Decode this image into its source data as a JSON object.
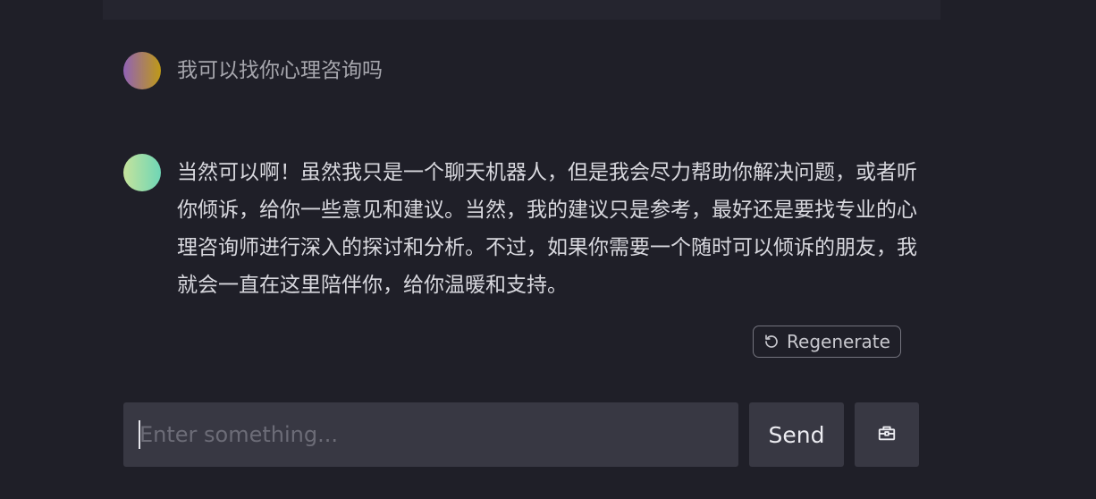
{
  "conversation": {
    "user_message": "我可以找你心理咨询吗",
    "bot_message": "当然可以啊！虽然我只是一个聊天机器人，但是我会尽力帮助你解决问题，或者听你倾诉，给你一些意见和建议。当然，我的建议只是参考，最好还是要找专业的心理咨询师进行深入的探讨和分析。不过，如果你需要一个随时可以倾诉的朋友，我就会一直在这里陪伴你，给你温暖和支持。"
  },
  "actions": {
    "regenerate_label": "Regenerate",
    "regenerate_icon": "refresh-icon"
  },
  "composer": {
    "value": "",
    "placeholder": "Enter something...",
    "send_label": "Send",
    "tool_icon": "toolbox-icon"
  },
  "colors": {
    "background": "#1f1f28",
    "panel": "#383843",
    "user_avatar_gradient": [
      "#9162b6",
      "#bf9a16"
    ],
    "bot_avatar_gradient": [
      "#c5e39c",
      "#6fd6b6"
    ]
  }
}
